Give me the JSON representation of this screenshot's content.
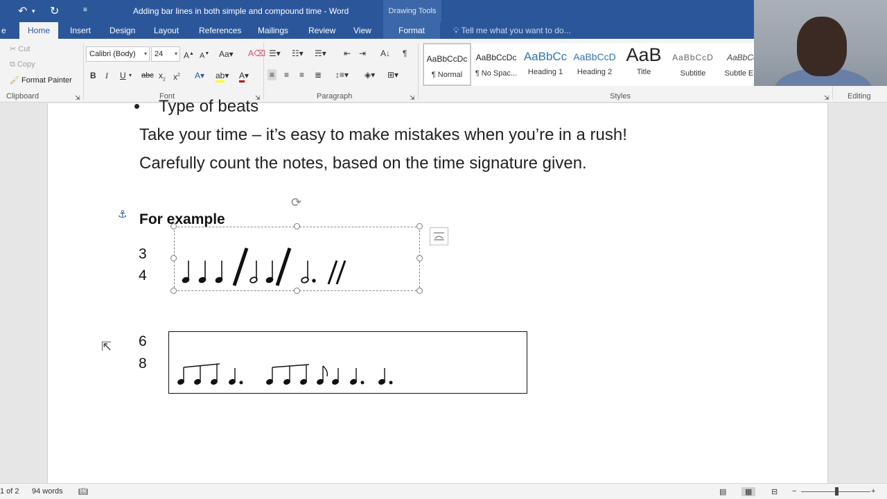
{
  "titlebar": {
    "title": "Adding bar lines in both simple and compound time - Word",
    "context_tab_group": "Drawing Tools"
  },
  "tabs": [
    {
      "label": "Home",
      "active": true
    },
    {
      "label": "Insert"
    },
    {
      "label": "Design"
    },
    {
      "label": "Layout"
    },
    {
      "label": "References"
    },
    {
      "label": "Mailings"
    },
    {
      "label": "Review"
    },
    {
      "label": "View"
    },
    {
      "label": "Format"
    }
  ],
  "tell_me": "Tell me what you want to do...",
  "clipboard": {
    "cut": "Cut",
    "copy": "Copy",
    "format_painter": "Format Painter",
    "label": "Clipboard"
  },
  "font": {
    "family": "Calibri (Body)",
    "size": "24",
    "label": "Font"
  },
  "paragraph": {
    "label": "Paragraph"
  },
  "styles": {
    "label": "Styles",
    "items": [
      {
        "sample": "AaBbCcDc",
        "name": "¶ Normal"
      },
      {
        "sample": "AaBbCcDc",
        "name": "¶ No Spac..."
      },
      {
        "sample": "AaBbCc",
        "name": "Heading 1"
      },
      {
        "sample": "AaBbCcD",
        "name": "Heading 2"
      },
      {
        "sample": "AaB",
        "name": "Title"
      },
      {
        "sample": "AaBbCcD",
        "name": "Subtitle"
      },
      {
        "sample": "AaBbCc",
        "name": "Subtle Em"
      }
    ]
  },
  "editing": {
    "label": "Editing"
  },
  "document": {
    "bullet": "Type of beats",
    "line1": "Take your time – it’s easy to make mistakes when you’re in a rush!",
    "line2": "Carefully count the notes, based on the time signature given.",
    "heading": "For example",
    "example1": {
      "top": "3",
      "bottom": "4"
    },
    "example2": {
      "top": "6",
      "bottom": "8"
    }
  },
  "status": {
    "page": "1 of 2",
    "words": "94 words"
  }
}
